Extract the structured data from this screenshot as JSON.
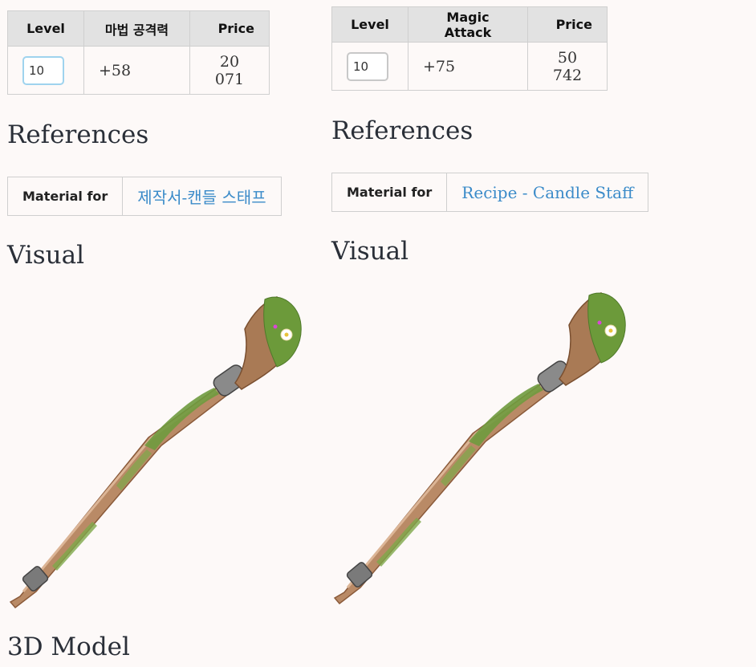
{
  "left": {
    "table": {
      "headers": {
        "level": "Level",
        "attack": "마법 공격력",
        "price": "Price"
      },
      "row": {
        "level_value": "10",
        "attack": "+58",
        "price": "20 071"
      }
    },
    "references": {
      "heading": "References",
      "label": "Material for",
      "link": "제작서-캔들 스태프"
    },
    "visual": {
      "heading": "Visual"
    },
    "model": {
      "heading": "3D Model"
    }
  },
  "right": {
    "table": {
      "headers": {
        "level": "Level",
        "attack": "Magic Attack",
        "price": "Price"
      },
      "row": {
        "level_value": "10",
        "attack": "+75",
        "price": "50 742"
      }
    },
    "references": {
      "heading": "References",
      "label": "Material for",
      "link": "Recipe - Candle Staff"
    },
    "visual": {
      "heading": "Visual"
    }
  },
  "colors": {
    "background": "#fdf9f8",
    "link": "#3b8bc9",
    "header_bg": "#e2e2e2",
    "input_focus": "#9fd3ee"
  },
  "icons": [
    "candle-staff-image"
  ]
}
